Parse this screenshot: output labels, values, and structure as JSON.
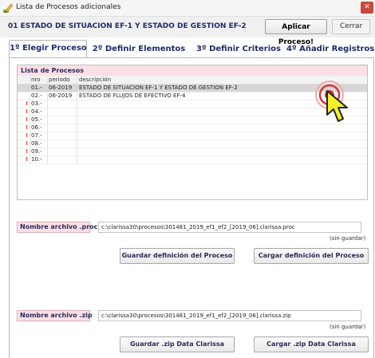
{
  "window": {
    "title": "Lista de Procesos adicionales",
    "close_glyph": "✕",
    "icon": "pencil-icon"
  },
  "header": {
    "process_name": "01 ESTADO DE SITUACION EF-1 Y ESTADO DE GESTION EF-2",
    "apply_button": "Aplicar Proceso!",
    "close_button": "Cerrar"
  },
  "tabs": [
    {
      "label": "1º Elegir Proceso",
      "active": true
    },
    {
      "label": "2º Definir Elementos",
      "active": false
    },
    {
      "label": "3º Definir Criterios",
      "active": false
    },
    {
      "label": "4º Añadir Registros",
      "active": false
    }
  ],
  "process_list": {
    "title": "Lista de Procesos",
    "columns": [
      "nro",
      "periodo",
      "descripción"
    ],
    "rows": [
      {
        "nro": "01.-",
        "periodo": "06-2019",
        "descripcion": "ESTADO DE SITUACION EF-1 Y ESTADO DE GESTION EF-2",
        "warning": "",
        "selected": true
      },
      {
        "nro": "02.-",
        "periodo": "06-2019",
        "descripcion": "ESTADO DE FLUJOS DE EFECTIVO EF-4",
        "warning": "",
        "selected": false
      },
      {
        "nro": "03.-",
        "periodo": "",
        "descripcion": "",
        "warning": "!",
        "selected": false
      },
      {
        "nro": "04.-",
        "periodo": "",
        "descripcion": "",
        "warning": "!",
        "selected": false
      },
      {
        "nro": "05.-",
        "periodo": "",
        "descripcion": "",
        "warning": "!",
        "selected": false
      },
      {
        "nro": "06.-",
        "periodo": "",
        "descripcion": "",
        "warning": "!",
        "selected": false
      },
      {
        "nro": "07.-",
        "periodo": "",
        "descripcion": "",
        "warning": "!",
        "selected": false
      },
      {
        "nro": "08.-",
        "periodo": "",
        "descripcion": "",
        "warning": "!",
        "selected": false
      },
      {
        "nro": "09.-",
        "periodo": "",
        "descripcion": "",
        "warning": "!",
        "selected": false
      },
      {
        "nro": "10.-",
        "periodo": "",
        "descripcion": "",
        "warning": "!",
        "selected": false
      }
    ]
  },
  "proc_file": {
    "label": "Nombre archivo .proc",
    "value": "c:\\clarissa30\\procesos\\301481_2019_ef1_ef2_[2019_06].clarissa.proc",
    "status": "(sin guardar)",
    "save_button": "Guardar definición del Proceso",
    "load_button": "Cargar definición del Proceso"
  },
  "zip_file": {
    "label": "Nombre archivo .zip",
    "value": "c:\\clarissa30\\procesos\\301481_2019_ef1_ef2_[2019_06].clarissa.zip",
    "status": "(sin guardar)",
    "save_button": "Guardar .zip Data Clarissa",
    "load_button": "Cargar .zip Data Clarissa"
  },
  "colors": {
    "label_bg": "#fde0e6",
    "accent_text": "#1e2c6c",
    "warning": "#d9381e",
    "cursor_yellow": "#f7f02a",
    "click_ring": "#d8343a"
  }
}
